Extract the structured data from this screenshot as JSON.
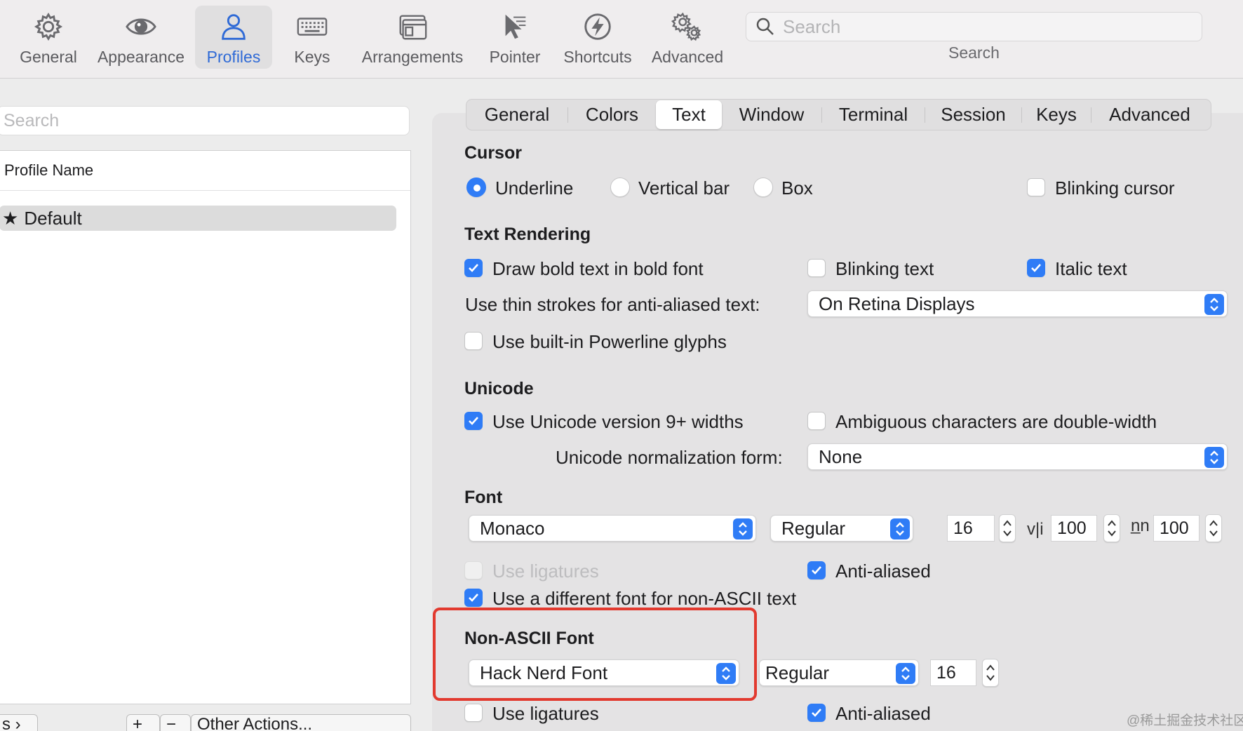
{
  "toolbar": {
    "items": [
      {
        "label": "General",
        "icon": "gear-icon"
      },
      {
        "label": "Appearance",
        "icon": "eye-icon"
      },
      {
        "label": "Profiles",
        "icon": "person-icon",
        "active": true
      },
      {
        "label": "Keys",
        "icon": "keyboard-icon"
      },
      {
        "label": "Arrangements",
        "icon": "window-icon"
      },
      {
        "label": "Pointer",
        "icon": "pointer-icon"
      },
      {
        "label": "Shortcuts",
        "icon": "bolt-icon"
      },
      {
        "label": "Advanced",
        "icon": "gears-icon"
      }
    ],
    "search_placeholder": "Search",
    "search_label": "Search"
  },
  "left": {
    "search_placeholder": "Search",
    "column_header": "Profile Name",
    "profiles": [
      {
        "name": "Default",
        "icon": "star-icon"
      }
    ],
    "bottom_tags_label": "s ›",
    "bottom_other_actions": "Other Actions...",
    "bottom_add": "+",
    "bottom_remove": "−"
  },
  "tabs": [
    "General",
    "Colors",
    "Text",
    "Window",
    "Terminal",
    "Session",
    "Keys",
    "Advanced"
  ],
  "active_tab": "Text",
  "cursor": {
    "title": "Cursor",
    "options": [
      "Underline",
      "Vertical bar",
      "Box"
    ],
    "selected": "Underline",
    "blinking_label": "Blinking cursor",
    "blinking": false
  },
  "text_rendering": {
    "title": "Text Rendering",
    "bold_label": "Draw bold text in bold font",
    "bold": true,
    "blinking_text_label": "Blinking text",
    "blinking_text": false,
    "italic_label": "Italic text",
    "italic": true,
    "thin_strokes_label": "Use thin strokes for anti-aliased text:",
    "thin_strokes_value": "On Retina Displays",
    "powerline_label": "Use built-in Powerline glyphs",
    "powerline": false
  },
  "unicode": {
    "title": "Unicode",
    "widths_label": "Use Unicode version 9+ widths",
    "widths": true,
    "ambiguous_label": "Ambiguous characters are double-width",
    "ambiguous": false,
    "normalization_label": "Unicode normalization form:",
    "normalization_value": "None"
  },
  "font": {
    "title": "Font",
    "family": "Monaco",
    "weight": "Regular",
    "size": "16",
    "vli_glyph": "v|i",
    "h_spacing": "100",
    "n_glyph": "n̲n",
    "v_spacing": "100",
    "ligatures_label": "Use ligatures",
    "ligatures": false,
    "anti_aliased_label": "Anti-aliased",
    "anti_aliased": true,
    "different_non_ascii_label": "Use a different font for non-ASCII text",
    "different_non_ascii": true
  },
  "non_ascii_font": {
    "title": "Non-ASCII Font",
    "family": "Hack Nerd Font",
    "weight": "Regular",
    "size": "16",
    "ligatures_label": "Use ligatures",
    "ligatures": false,
    "anti_aliased_label": "Anti-aliased",
    "anti_aliased": true
  },
  "watermark": "@稀土掘金技术社区",
  "colors": {
    "accent": "#2f7cf6",
    "highlight": "#e23a2f",
    "active_label": "#2f6ad6"
  }
}
